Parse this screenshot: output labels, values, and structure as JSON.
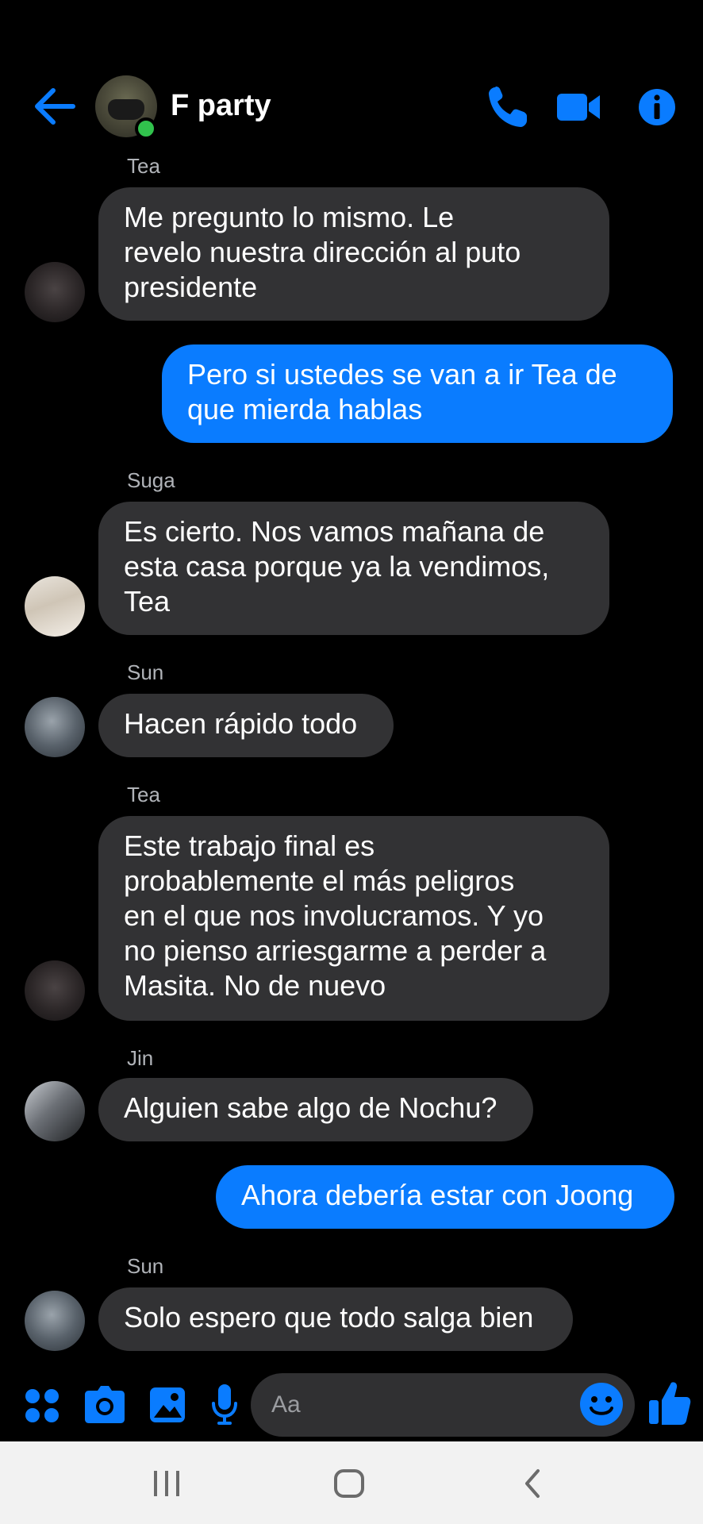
{
  "header": {
    "title": "F party",
    "back_icon": "arrow-left-icon",
    "actions": [
      "phone-icon",
      "video-camera-icon",
      "info-icon"
    ]
  },
  "accent_color": "#0a7cff",
  "messages": [
    {
      "sender": "Tea",
      "direction": "in",
      "lines": [
        "Me pregunto lo mismo. Le",
        "revelo nuestra dirección al puto",
        "presidente"
      ]
    },
    {
      "direction": "out",
      "lines": [
        "Pero si ustedes se van a ir Tea de",
        "que mierda hablas"
      ]
    },
    {
      "sender": "Suga",
      "direction": "in",
      "lines": [
        "Es cierto. Nos vamos mañana de",
        "esta casa porque ya la vendimos,",
        "Tea"
      ]
    },
    {
      "sender": "Sun",
      "direction": "in",
      "lines": [
        "Hacen rápido todo"
      ]
    },
    {
      "sender": "Tea",
      "direction": "in",
      "lines": [
        "Este trabajo final es",
        "probablemente el más peligros",
        "en el que nos involucramos. Y yo",
        "no pienso arriesgarme a perder a",
        "Masita. No de nuevo"
      ]
    },
    {
      "sender": "Jin",
      "direction": "in",
      "lines": [
        "Alguien sabe algo de Nochu?"
      ]
    },
    {
      "direction": "out",
      "lines": [
        "Ahora debería estar con Joong"
      ]
    },
    {
      "sender": "Sun",
      "direction": "in",
      "lines": [
        "Solo espero que todo salga bien"
      ]
    }
  ],
  "composer": {
    "placeholder": "Aa",
    "icons": [
      "apps-grid-icon",
      "camera-icon",
      "gallery-icon",
      "microphone-icon",
      "emoji-icon",
      "thumbs-up-icon"
    ]
  },
  "system_nav": [
    "recent-apps-icon",
    "home-icon",
    "back-icon"
  ]
}
